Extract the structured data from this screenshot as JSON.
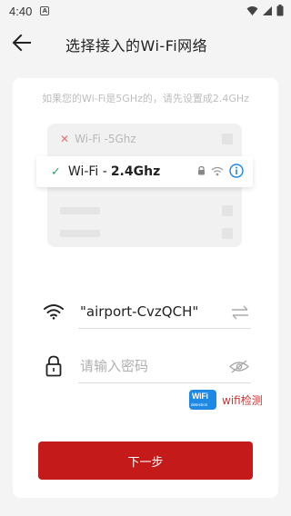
{
  "status_bar": {
    "time": "4:40",
    "badge": "A"
  },
  "header": {
    "title": "选择接入的Wi-Fi网络"
  },
  "hint": "如果您的Wi-Fi是5GHz的，请先设置成2.4GHz",
  "illustration": {
    "row_5g": {
      "prefix": "Wi-Fi - ",
      "band": "5Ghz"
    },
    "row_24": {
      "prefix": "Wi-Fi - ",
      "band": "2.4Ghz"
    }
  },
  "ssid": {
    "value": "\"airport-CvzQCH\""
  },
  "password": {
    "placeholder": "请输入密码",
    "value": ""
  },
  "wifi_detect": {
    "logo_text": "WiFi",
    "logo_sub": "detection",
    "label": "wifi检测"
  },
  "next_button": {
    "label": "下一步"
  },
  "colors": {
    "accent": "#c41a1a",
    "check": "#2ea56a",
    "info": "#1e88e5"
  }
}
